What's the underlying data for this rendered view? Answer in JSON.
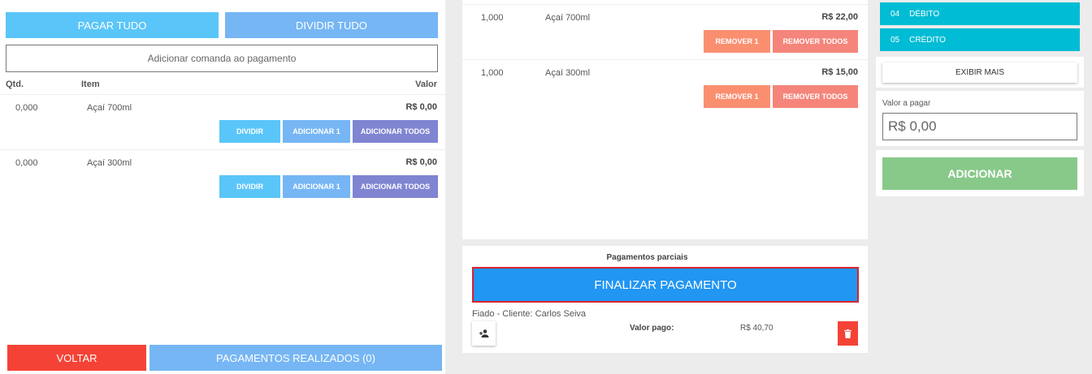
{
  "left": {
    "pay_all": "PAGAR TUDO",
    "split_all": "DIVIDIR TUDO",
    "add_comanda": "Adicionar comanda ao pagamento",
    "headers": {
      "qty": "Qtd.",
      "item": "Item",
      "value": "Valor"
    },
    "items": [
      {
        "qty": "0,000",
        "name": "Açaí 700ml",
        "value": "R$ 0,00"
      },
      {
        "qty": "0,000",
        "name": "Açaí 300ml",
        "value": "R$ 0,00"
      }
    ],
    "btn_divide": "DIVIDIR",
    "btn_add_one": "ADICIONAR 1",
    "btn_add_all": "ADICIONAR TODOS",
    "back": "VOLTAR",
    "payments_done": "PAGAMENTOS REALIZADOS (0)"
  },
  "middle": {
    "items": [
      {
        "qty": "1,000",
        "name": "Açaí 700ml",
        "value": "R$ 22,00"
      },
      {
        "qty": "1,000",
        "name": "Açaí 300ml",
        "value": "R$ 15,00"
      }
    ],
    "btn_remove_one": "REMOVER 1",
    "btn_remove_all": "REMOVER TODOS",
    "partial_title": "Pagamentos parciais",
    "finalize": "FINALIZAR PAGAMENTO",
    "fiado": "Fiado - Cliente: Carlos Seiva",
    "paid_label": "Valor pago:",
    "paid_value": "R$ 40,70"
  },
  "right": {
    "methods": [
      {
        "code": "04",
        "label": "DÉBITO"
      },
      {
        "code": "05",
        "label": "CRÉDITO"
      }
    ],
    "show_more": "EXIBIR MAIS",
    "pay_label": "Valor a pagar",
    "pay_value": "R$ 0,00",
    "add": "ADICIONAR"
  },
  "colors": {
    "pay_all": "#5ac5f8",
    "split": "#76b6f4",
    "add_all": "#7f85d1",
    "remove_one": "#fa8f70",
    "remove_all": "#f5857b",
    "finalize": "#2196f3",
    "danger": "#f44336",
    "method": "#00bcd4",
    "add": "#88c98a"
  }
}
